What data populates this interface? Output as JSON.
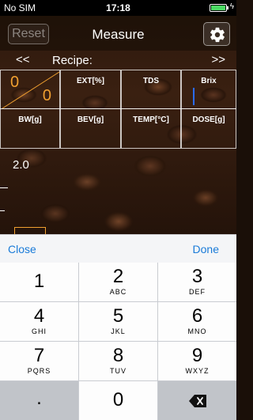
{
  "status_bar": {
    "carrier": "No SIM",
    "time": "17:18",
    "battery_percent": 100,
    "charging_icon": "bolt-icon"
  },
  "nav": {
    "reset_label": "Reset",
    "title": "Measure",
    "settings_icon": "gear-icon"
  },
  "recipe": {
    "prev": "<<",
    "label": "Recipe:",
    "next": ">>"
  },
  "grid": {
    "ratio_top": "0",
    "ratio_bottom": "0",
    "headers_row1": [
      "EXT[%]",
      "TDS",
      "Brix"
    ],
    "headers_row2": [
      "BW[g]",
      "BEV[g]",
      "TEMP[°C]",
      "DOSE[g]"
    ]
  },
  "graph": {
    "value": "2.0"
  },
  "accessory": {
    "close_label": "Close",
    "done_label": "Done"
  },
  "keypad": {
    "keys": [
      {
        "num": "1",
        "letters": ""
      },
      {
        "num": "2",
        "letters": "ABC"
      },
      {
        "num": "3",
        "letters": "DEF"
      },
      {
        "num": "4",
        "letters": "GHI"
      },
      {
        "num": "5",
        "letters": "JKL"
      },
      {
        "num": "6",
        "letters": "MNO"
      },
      {
        "num": "7",
        "letters": "PQRS"
      },
      {
        "num": "8",
        "letters": "TUV"
      },
      {
        "num": "9",
        "letters": "WXYZ"
      },
      {
        "num": "0",
        "letters": ""
      }
    ],
    "decimal": ".",
    "backspace_icon": "backspace-icon"
  },
  "colors": {
    "accent_orange": "#f0a030",
    "link_blue": "#1a7bd8",
    "cursor_blue": "#2a6bff"
  }
}
